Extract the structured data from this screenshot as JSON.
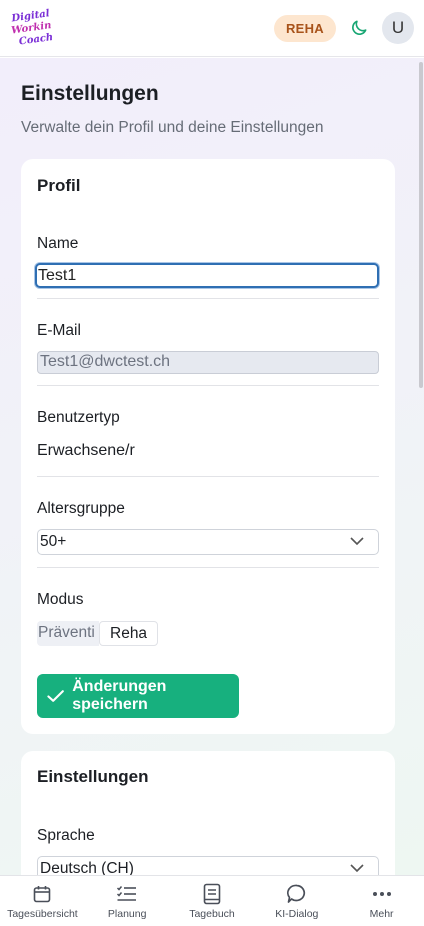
{
  "header": {
    "logo_text": [
      "Digital",
      "Working",
      "Coach"
    ],
    "badge": "REHA",
    "avatar_initial": "U"
  },
  "page": {
    "title": "Einstellungen",
    "subtitle": "Verwalte dein Profil und deine Einstellungen"
  },
  "profile": {
    "title": "Profil",
    "name_label": "Name",
    "name_value": "Test1",
    "email_label": "E-Mail",
    "email_value": "Test1@dwctest.ch",
    "usertype_label": "Benutzertyp",
    "usertype_value": "Erwachsene/r",
    "agegroup_label": "Altersgruppe",
    "agegroup_value": "50+",
    "mode_label": "Modus",
    "mode_options": [
      "Präventi",
      "Reha"
    ],
    "mode_selected": "Reha",
    "save_label": "Änderungen speichern"
  },
  "settings": {
    "title": "Einstellungen",
    "language_label": "Sprache",
    "language_value": "Deutsch (CH)"
  },
  "nav": {
    "items": [
      {
        "label": "Tagesübersicht",
        "icon": "calendar-icon"
      },
      {
        "label": "Planung",
        "icon": "checklist-icon"
      },
      {
        "label": "Tagebuch",
        "icon": "book-icon"
      },
      {
        "label": "KI-Dialog",
        "icon": "chat-icon"
      },
      {
        "label": "Mehr",
        "icon": "more-icon"
      }
    ]
  },
  "colors": {
    "accent": "#17b07e",
    "badge_bg": "#fde6cf",
    "badge_text": "#a8531a",
    "focus_border": "#2f6fb3"
  }
}
